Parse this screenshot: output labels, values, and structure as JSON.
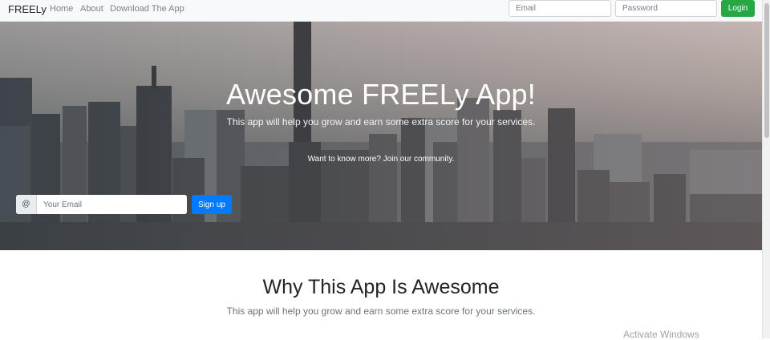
{
  "navbar": {
    "brand": "FREELy",
    "links": [
      "Home",
      "About",
      "Download The App"
    ],
    "email_placeholder": "Email",
    "password_placeholder": "Password",
    "login_label": "Login"
  },
  "hero": {
    "title": "Awesome FREELy App!",
    "subtitle": "This app will help you grow and earn some extra score for your services.",
    "cta_text": "Want to know more? Join our community.",
    "email_addon": "@",
    "email_placeholder": "Your Email",
    "signup_label": "Sign up"
  },
  "section": {
    "title": "Why This App Is Awesome",
    "subtitle": "This app will help you grow and earn some extra score for your services."
  },
  "watermark": "Activate Windows",
  "colors": {
    "login_green": "#28a745",
    "primary_blue": "#007bff",
    "navbar_bg": "#f8f9fa"
  }
}
